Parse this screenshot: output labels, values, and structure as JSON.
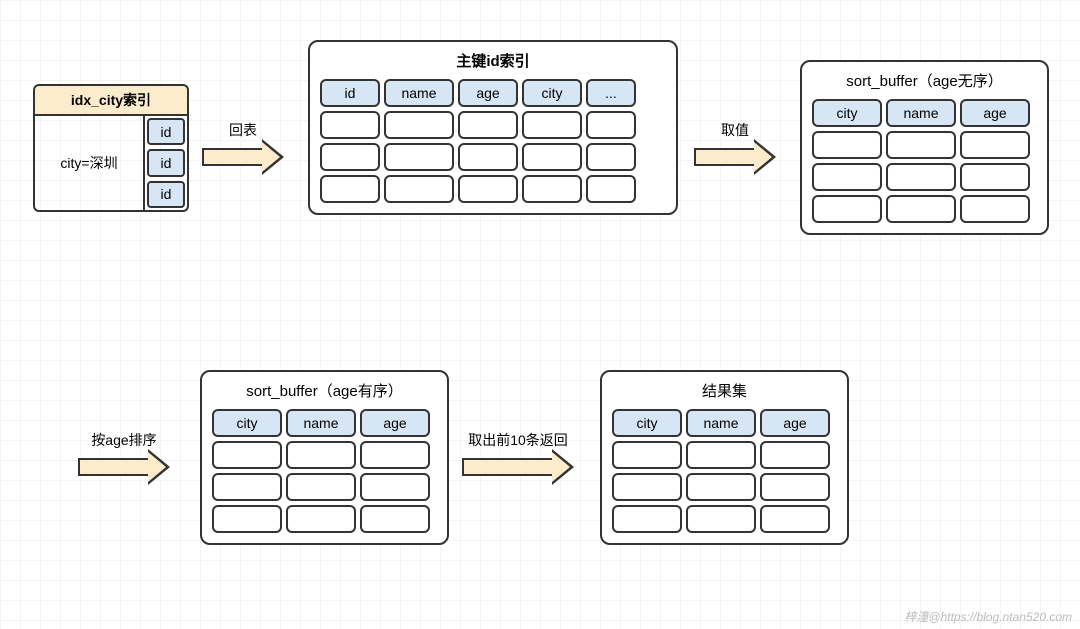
{
  "idx_city": {
    "title": "idx_city索引",
    "condition": "city=深圳",
    "ids": [
      "id",
      "id",
      "id"
    ]
  },
  "primary": {
    "title": "主键id索引",
    "columns": [
      "id",
      "name",
      "age",
      "city",
      "..."
    ]
  },
  "buffer_unsorted": {
    "title": "sort_buffer（age无序）",
    "columns": [
      "city",
      "name",
      "age"
    ]
  },
  "buffer_sorted": {
    "title": "sort_buffer（age有序）",
    "columns": [
      "city",
      "name",
      "age"
    ]
  },
  "result": {
    "title": "结果集",
    "columns": [
      "city",
      "name",
      "age"
    ]
  },
  "arrows": {
    "back_table": "回表",
    "get_value": "取值",
    "sort": "按age排序",
    "take10": "取出前10条返回"
  },
  "watermark": "梓潼@https://blog.ntan520.com"
}
